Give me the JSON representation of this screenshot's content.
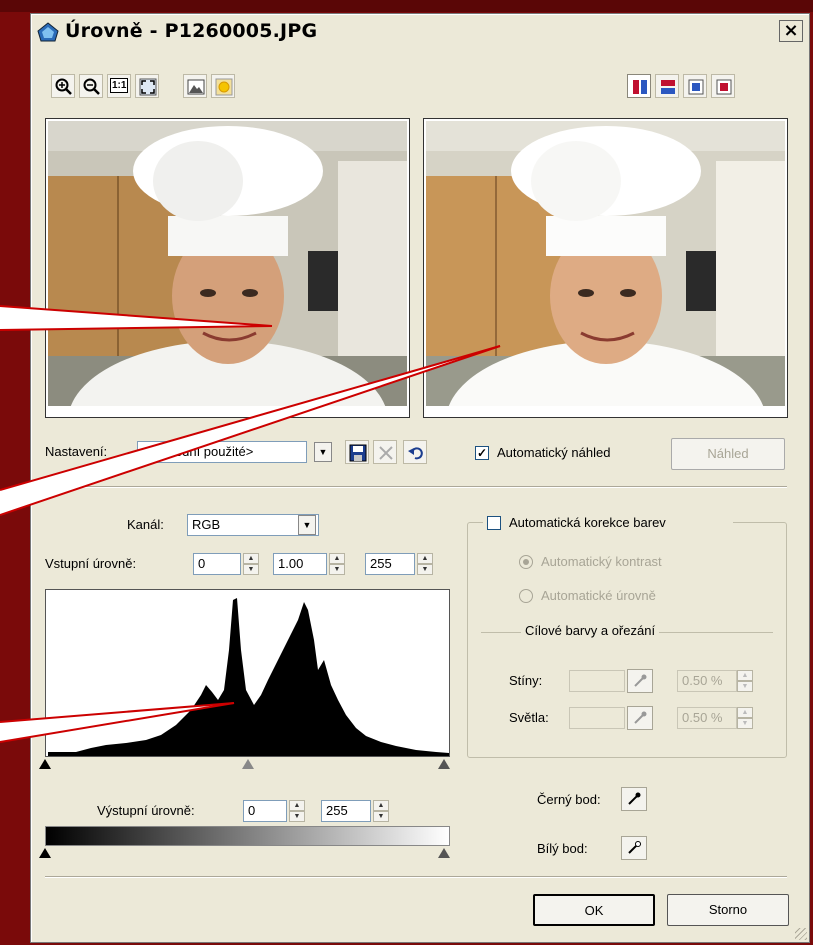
{
  "window": {
    "title": "Úrovně - P1260005.JPG",
    "close_glyph": "×"
  },
  "toolbar": {
    "left_icons": [
      "zoom-in-icon",
      "zoom-out-icon",
      "actual-size-icon",
      "fit-to-window-icon",
      "landscape-icon",
      "sun-icon"
    ],
    "actual_size_label": "1:1",
    "right_icons": [
      "split-vertical-icon",
      "split-horizontal-icon",
      "single-view-blue-icon",
      "single-view-red-icon"
    ]
  },
  "settings": {
    "label": "Nastavení:",
    "value": "<Poslední použité>",
    "auto_preview_label": "Automatický náhled",
    "auto_preview_checked": true,
    "preview_button": "Náhled"
  },
  "levels": {
    "channel_label": "Kanál:",
    "channel_value": "RGB",
    "input_label": "Vstupní úrovně:",
    "input_values": [
      "0",
      "1.00",
      "255"
    ],
    "output_label": "Výstupní úrovně:",
    "output_values": [
      "0",
      "255"
    ]
  },
  "auto_color": {
    "group_label": "Automatická korekce barev",
    "checked": false,
    "auto_contrast": "Automatický kontrast",
    "auto_levels": "Automatické úrovně",
    "target_group": "Cílové barvy a ořezání",
    "shadows_label": "Stíny:",
    "shadows_value": "0.50 %",
    "highlights_label": "Světla:",
    "highlights_value": "0.50 %"
  },
  "points": {
    "black_label": "Černý bod:",
    "white_label": "Bílý bod:"
  },
  "buttons": {
    "ok": "OK",
    "cancel": "Storno"
  },
  "colors": {
    "background": "#7a0a0a",
    "dialog": "#ece9d8",
    "callout": "#cc0000"
  }
}
